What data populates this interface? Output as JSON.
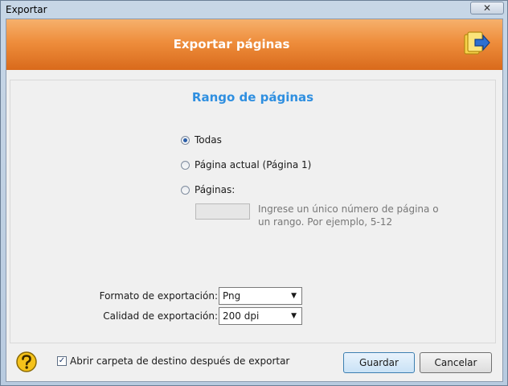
{
  "window": {
    "title": "Exportar",
    "close_label": "✕"
  },
  "header": {
    "title": "Exportar páginas"
  },
  "range": {
    "title": "Rango de páginas",
    "options": [
      {
        "label": "Todas",
        "checked": true
      },
      {
        "label": "Página actual (Página  1)",
        "checked": false
      },
      {
        "label": "Páginas:",
        "checked": false
      }
    ],
    "pages_input_value": "",
    "hint": "Ingrese un único número de página o un rango. Por ejemplo, 5-12"
  },
  "format": {
    "label": "Formato de exportación:",
    "value": "Png"
  },
  "quality": {
    "label": "Calidad de exportación:",
    "value": "200 dpi"
  },
  "open_folder": {
    "label": "Abrir carpeta de destino después de exportar",
    "checked": true
  },
  "buttons": {
    "save": "Guardar",
    "cancel": "Cancelar"
  },
  "colors": {
    "accent": "#ee8d3c",
    "section_title": "#2f8fe0"
  }
}
